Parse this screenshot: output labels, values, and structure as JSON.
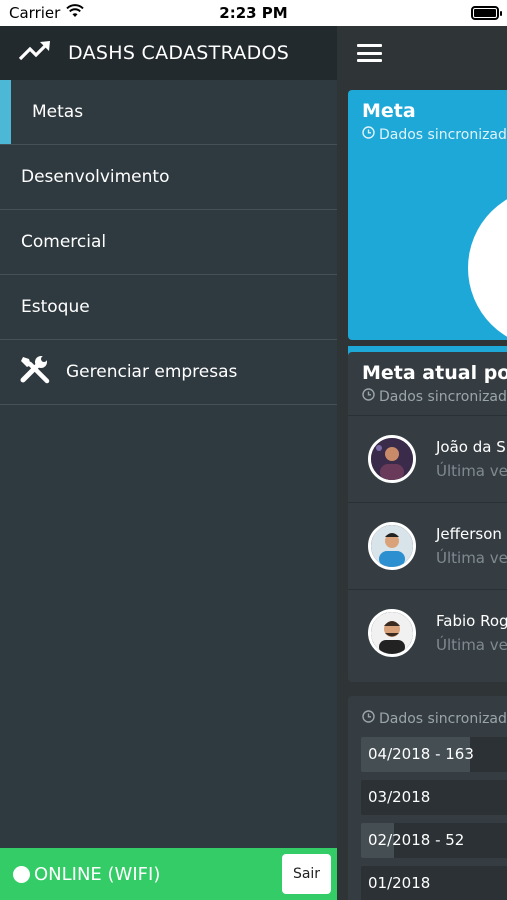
{
  "status_bar": {
    "carrier": "Carrier",
    "time": "2:23 PM"
  },
  "drawer": {
    "title": "DASHS CADASTRADOS",
    "items": [
      {
        "label": "Metas",
        "active": true
      },
      {
        "label": "Desenvolvimento"
      },
      {
        "label": "Comercial"
      },
      {
        "label": "Estoque"
      },
      {
        "label": "Gerenciar empresas",
        "icon": "tools-icon"
      }
    ],
    "connection_status": "ONLINE (WIFI)",
    "logout_label": "Sair"
  },
  "main": {
    "meta_card": {
      "title": "Meta",
      "sync_text": "Dados sincronizados",
      "color": "#1ea8d8"
    },
    "goal_card": {
      "title": "Meta atual por vendedor",
      "sync_text": "Dados sincronizados",
      "people": [
        {
          "name": "João da Silva",
          "sub": "Última venda"
        },
        {
          "name": "Jefferson",
          "sub": "Última venda"
        },
        {
          "name": "Fabio Rogério",
          "sub": "Última venda"
        }
      ]
    },
    "history_card": {
      "sync_text": "Dados sincronizados",
      "rows": [
        {
          "label": "04/2018 - 163",
          "progress": 0.65
        },
        {
          "label": "03/2018",
          "progress": 0.0
        },
        {
          "label": "02/2018 - 52",
          "progress": 0.2
        },
        {
          "label": "01/2018",
          "progress": 0.0
        }
      ]
    }
  },
  "colors": {
    "accent": "#4db8d6",
    "online": "#33cc66",
    "drawer_bg": "#2f3a40"
  }
}
